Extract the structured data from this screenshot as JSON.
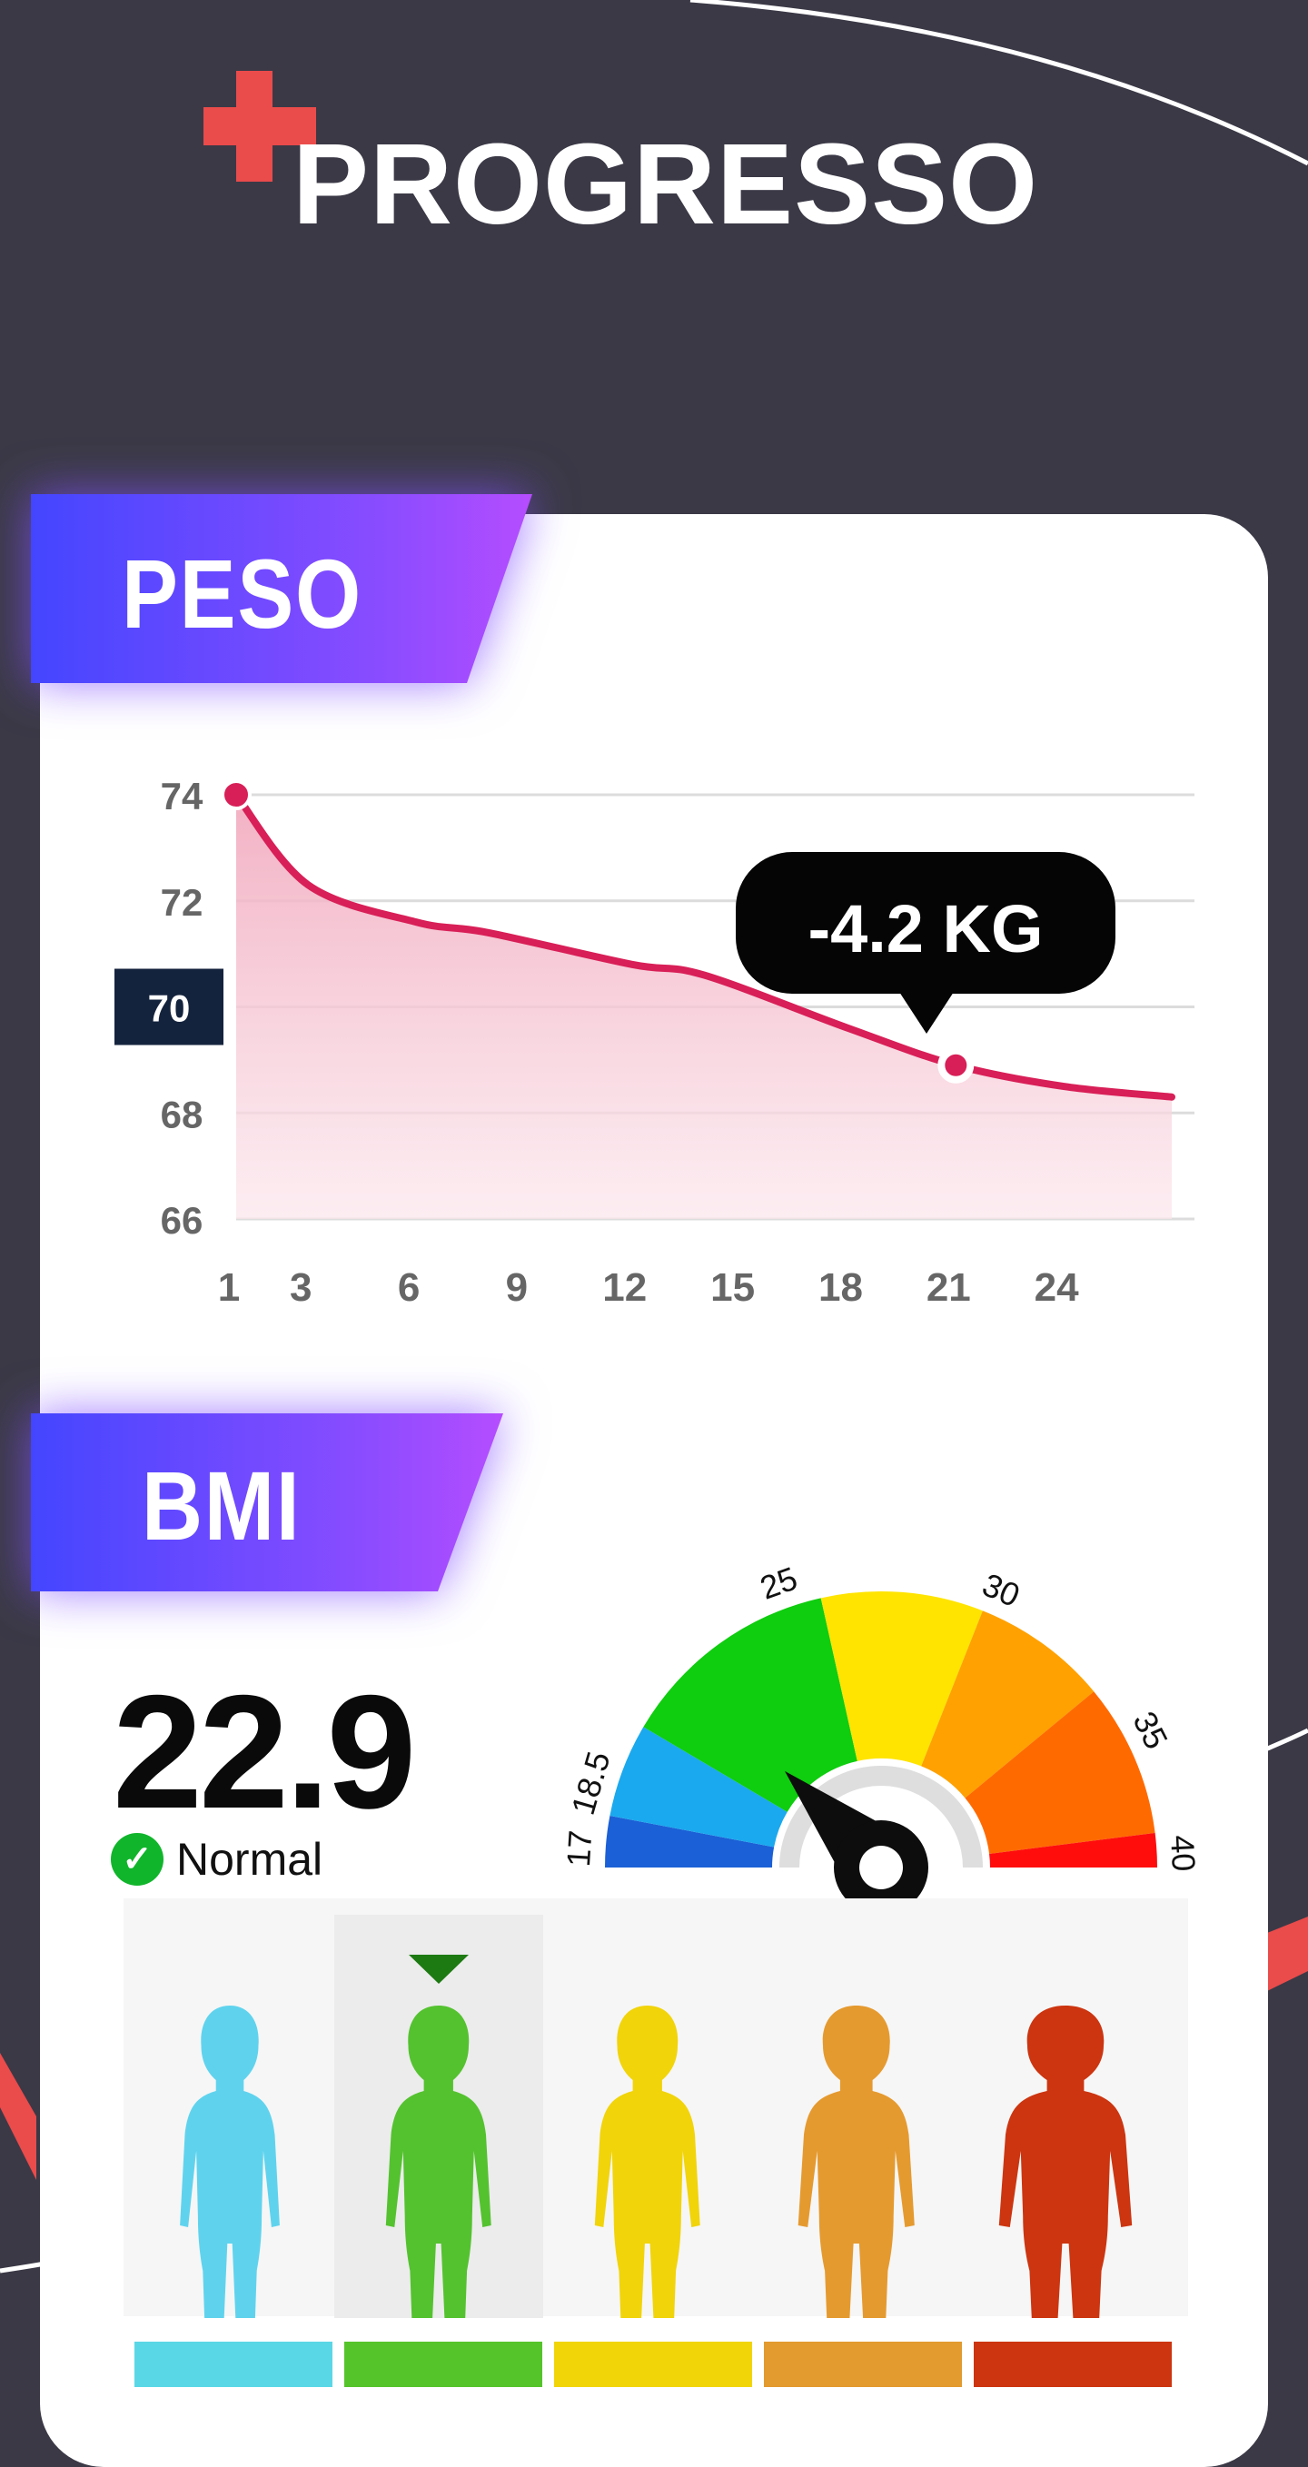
{
  "header": {
    "title": "PROGRESSO"
  },
  "weight": {
    "section_label": "PESO",
    "badge": "-4.2 KG",
    "highlight_tick": "70"
  },
  "chart_data": {
    "type": "line",
    "title": "",
    "xlabel": "",
    "ylabel": "",
    "x": [
      1,
      3,
      6,
      8,
      12,
      14,
      18,
      21,
      24,
      27
    ],
    "values": [
      74.0,
      72.3,
      71.6,
      71.4,
      70.8,
      70.6,
      69.6,
      68.9,
      68.5,
      68.3
    ],
    "ylim": [
      66,
      74
    ],
    "xlim": [
      1,
      27
    ],
    "xticks": [
      1,
      3,
      6,
      9,
      12,
      15,
      18,
      21,
      24
    ],
    "yticks": [
      66,
      68,
      70,
      72,
      74
    ],
    "grid": true,
    "colors": {
      "line": "#d81f57",
      "fill_top": "#f1a8bd",
      "fill_bottom": "#fbe6ec",
      "grid": "#dcdcdc",
      "tick": "#666666"
    }
  },
  "bmi": {
    "section_label": "BMI",
    "value": "22.9",
    "status": "Normal",
    "gauge": {
      "min": 17,
      "max": 40,
      "value": 22.9,
      "tick_labels": [
        "17",
        "18.5",
        "25",
        "30",
        "35",
        "40"
      ],
      "tick_values": [
        17,
        18.5,
        25,
        30,
        35,
        40
      ],
      "segment_colors": [
        "#1b60d6",
        "#1aa9ee",
        "#0fcd0f",
        "#ffe400",
        "#ffa100",
        "#ff6a00",
        "#ff0d0d"
      ]
    },
    "figures": [
      {
        "name": "underweight",
        "color": "#5fd3ee"
      },
      {
        "name": "normal",
        "color": "#54c22f",
        "selected": true
      },
      {
        "name": "overweight",
        "color": "#f1d40a"
      },
      {
        "name": "obese",
        "color": "#e59a2f"
      },
      {
        "name": "extremely-obese",
        "color": "#cc3510"
      }
    ],
    "bar_colors": [
      "#5ad7e6",
      "#55c42b",
      "#f1d508",
      "#e39a2f",
      "#cc3510"
    ],
    "selected_marker_color": "#1d7a12"
  },
  "theme": {
    "background": "#3b3946",
    "accent": "#ea4b4b",
    "card": "#ffffff"
  }
}
